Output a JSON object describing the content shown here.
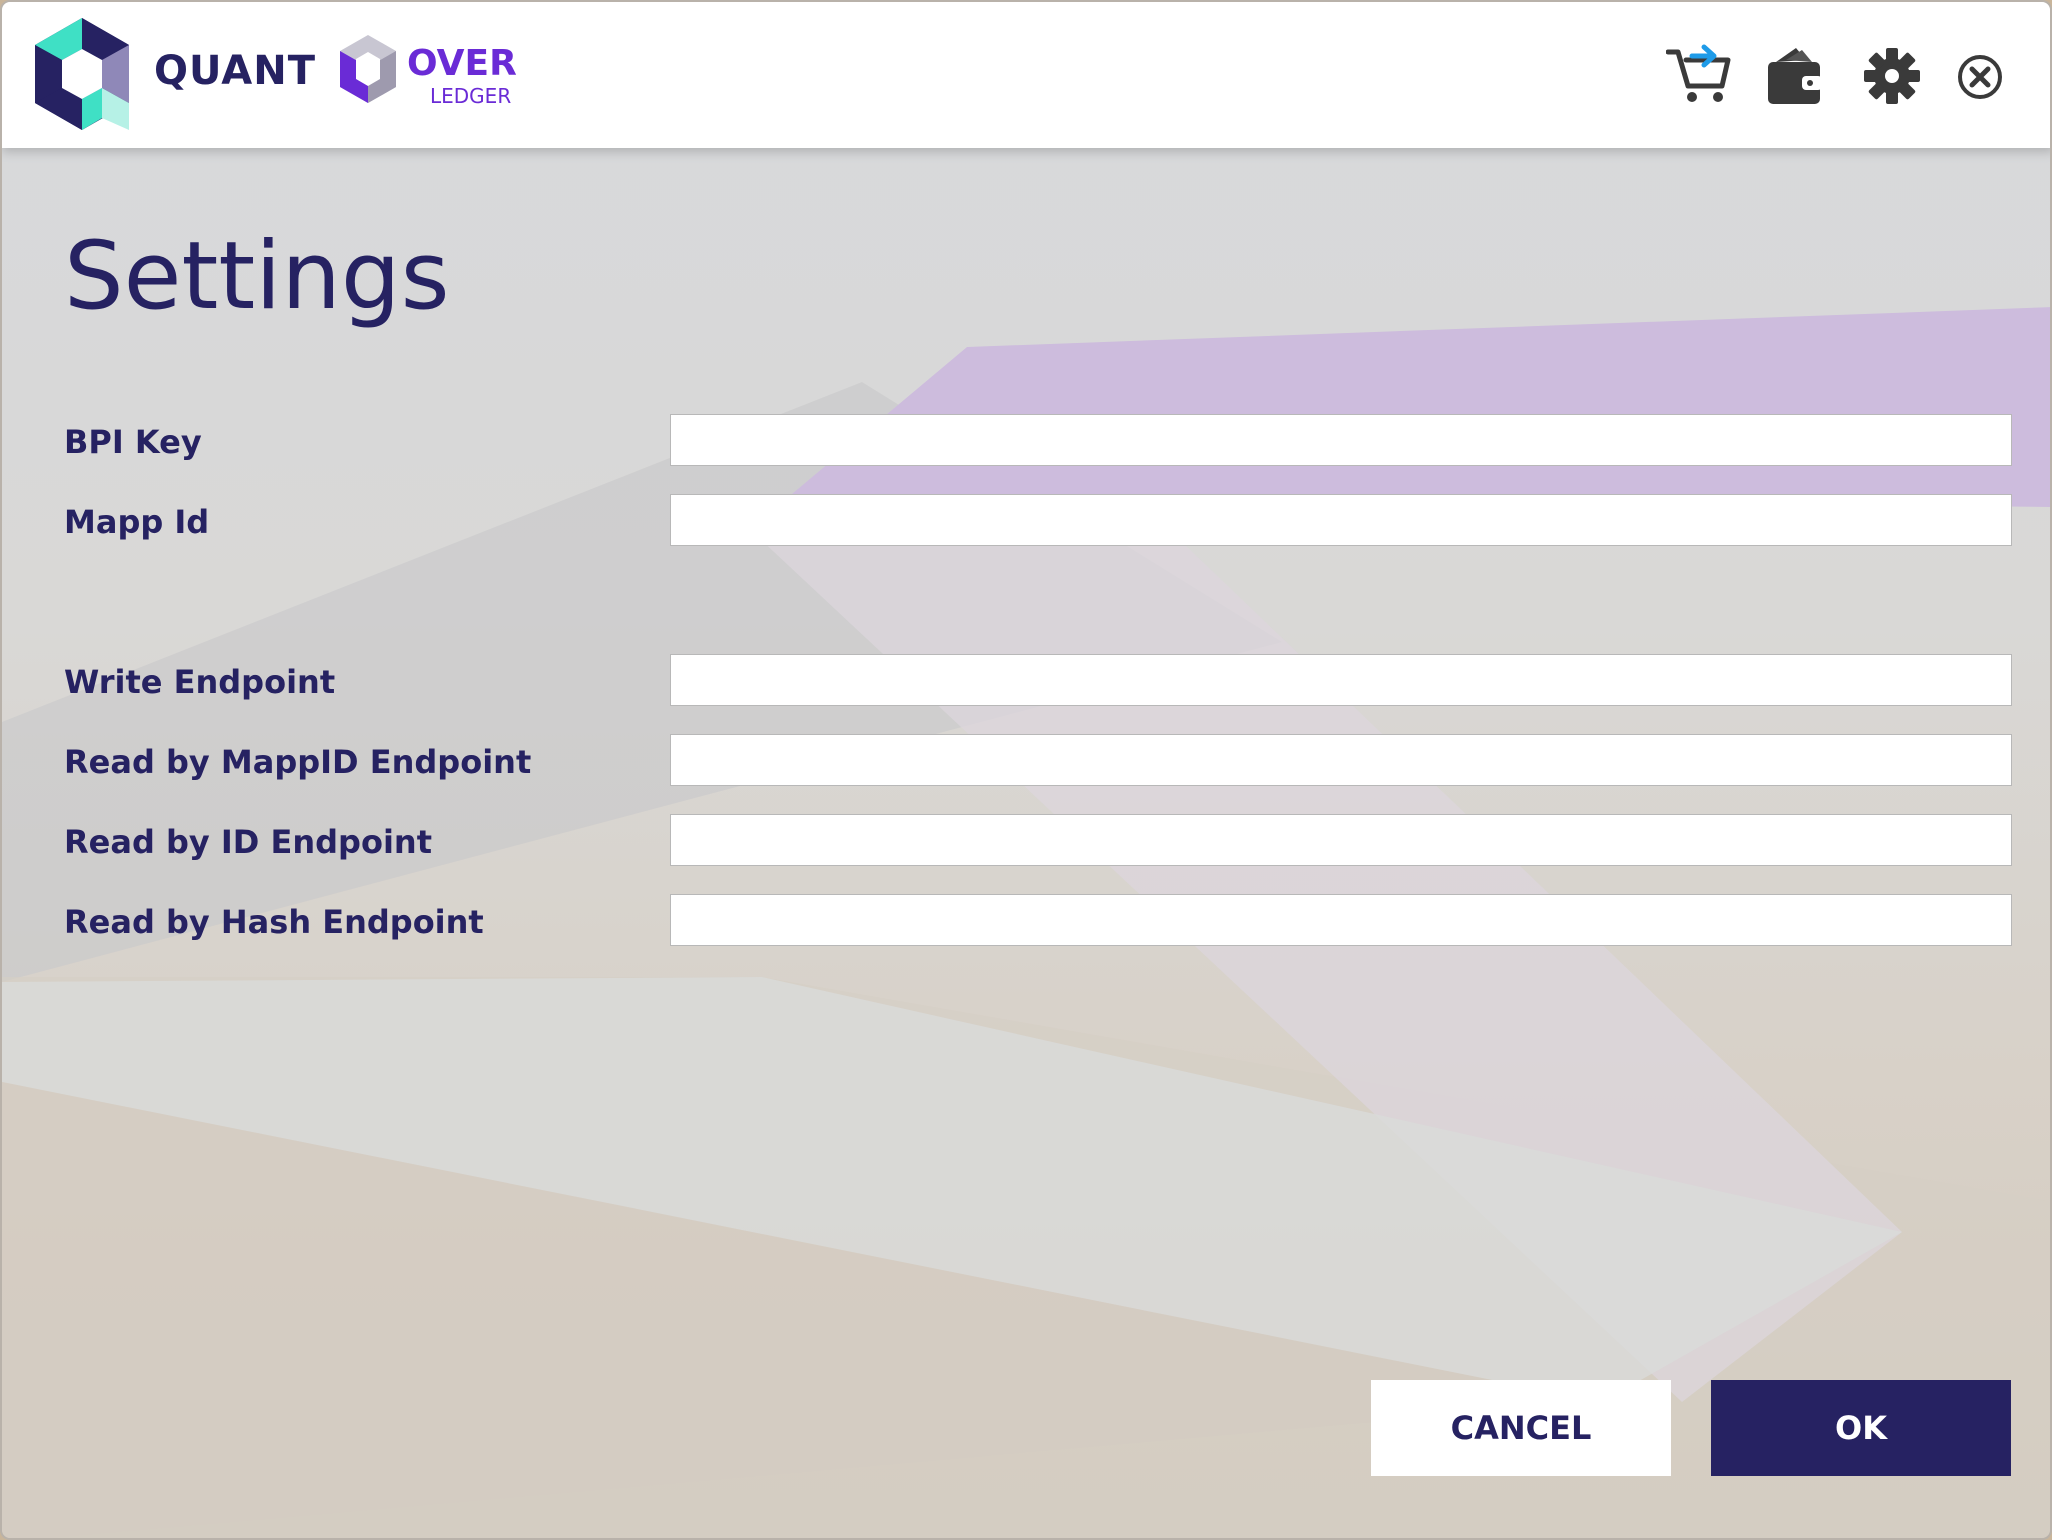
{
  "header": {
    "brand_quant": "QUANT",
    "brand_over": "OVER",
    "brand_ledger": "LEDGER"
  },
  "icons": {
    "cart": "cart-transfer-icon",
    "wallet": "wallet-icon",
    "settings": "gear-icon",
    "close": "close-icon"
  },
  "page": {
    "title": "Settings"
  },
  "fields": [
    {
      "label": "BPI Key",
      "value": ""
    },
    {
      "label": "Mapp Id",
      "value": ""
    },
    {
      "label": "Write Endpoint",
      "value": ""
    },
    {
      "label": "Read by MappID Endpoint",
      "value": ""
    },
    {
      "label": "Read by ID Endpoint",
      "value": ""
    },
    {
      "label": "Read by Hash Endpoint",
      "value": ""
    }
  ],
  "buttons": {
    "cancel": "CANCEL",
    "ok": "OK"
  },
  "colors": {
    "brand_navy": "#262262",
    "brand_purple": "#6a2bd6",
    "accent_teal": "#3fe0c5",
    "cart_arrow": "#1e9be8"
  }
}
